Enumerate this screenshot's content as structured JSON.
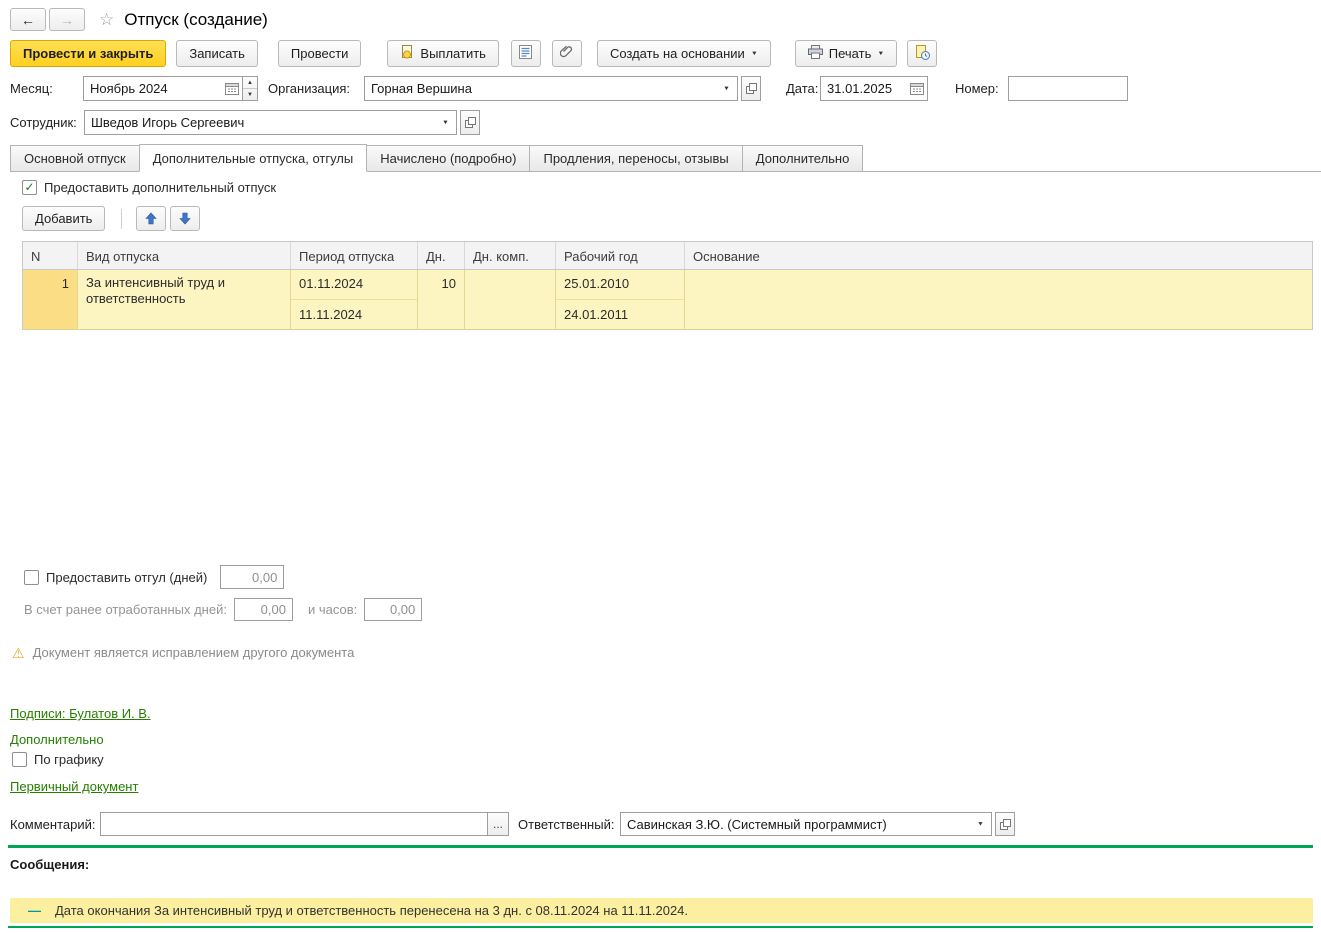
{
  "window": {
    "title": "Отпуск (создание)"
  },
  "icons": {
    "back": "←",
    "forward": "→",
    "star": "☆",
    "caret_down": "▼",
    "spinner_up": "▲",
    "spinner_down": "▼",
    "warning": "⚠",
    "check": "✓",
    "message_dash": "—"
  },
  "toolbar": {
    "post_and_close": "Провести и закрыть",
    "write": "Записать",
    "post": "Провести",
    "pay": "Выплатить",
    "create_based_on": "Создать на основании",
    "print": "Печать"
  },
  "fields": {
    "month_label": "Месяц:",
    "month_value": "Ноябрь 2024",
    "organization_label": "Организация:",
    "organization_value": "Горная Вершина",
    "date_label": "Дата:",
    "date_value": "31.01.2025",
    "number_label": "Номер:",
    "number_value": "",
    "employee_label": "Сотрудник:",
    "employee_value": "Шведов Игорь Сергеевич"
  },
  "tabs": [
    {
      "label": "Основной отпуск"
    },
    {
      "label": "Дополнительные отпуска, отгулы"
    },
    {
      "label": "Начислено (подробно)"
    },
    {
      "label": "Продления, переносы, отзывы"
    },
    {
      "label": "Дополнительно"
    }
  ],
  "vacation_section": {
    "provide_additional_label": "Предоставить дополнительный отпуск",
    "add_button": "Добавить"
  },
  "table": {
    "headers": [
      "N",
      "Вид отпуска",
      "Период отпуска",
      "Дн.",
      "Дн. комп.",
      "Рабочий год",
      "Основание"
    ],
    "rows": [
      {
        "n": "1",
        "type": "За интенсивный труд и ответственность",
        "period_start": "01.11.2024",
        "period_end": "11.11.2024",
        "days": "10",
        "comp_days": "",
        "work_year_start": "25.01.2010",
        "work_year_end": "24.01.2011",
        "basis": ""
      }
    ]
  },
  "timeoff": {
    "provide_label": "Предоставить отгул (дней)",
    "provide_value": "0,00",
    "earned_days_label": "В счет ранее отработанных дней:",
    "earned_days_value": "0,00",
    "hours_label": "и часов:",
    "hours_value": "0,00"
  },
  "warning": {
    "text": "Документ является исправлением другого документа"
  },
  "links": {
    "signatures": "Подписи: Булатов И. В.",
    "additional": "Дополнительно",
    "schedule_label": "По графику",
    "primary_document": "Первичный документ"
  },
  "footer": {
    "comment_label": "Комментарий:",
    "comment_value": "",
    "comment_more": "...",
    "responsible_label": "Ответственный:",
    "responsible_value": "Савинская З.Ю. (Системный программист)"
  },
  "messages": {
    "title": "Сообщения:",
    "items": [
      {
        "text": "Дата окончания За интенсивный труд и ответственность перенесена на 3 дн. с 08.11.2024 на 11.11.2024."
      }
    ]
  },
  "colors": {
    "accent_yellow": "#ffd42e",
    "link_green": "#267f00",
    "separator_green": "#00a651",
    "row_highlight": "#fdf5c1",
    "row_marker": "#fbdd85",
    "message_bg": "#fcf0a0"
  }
}
